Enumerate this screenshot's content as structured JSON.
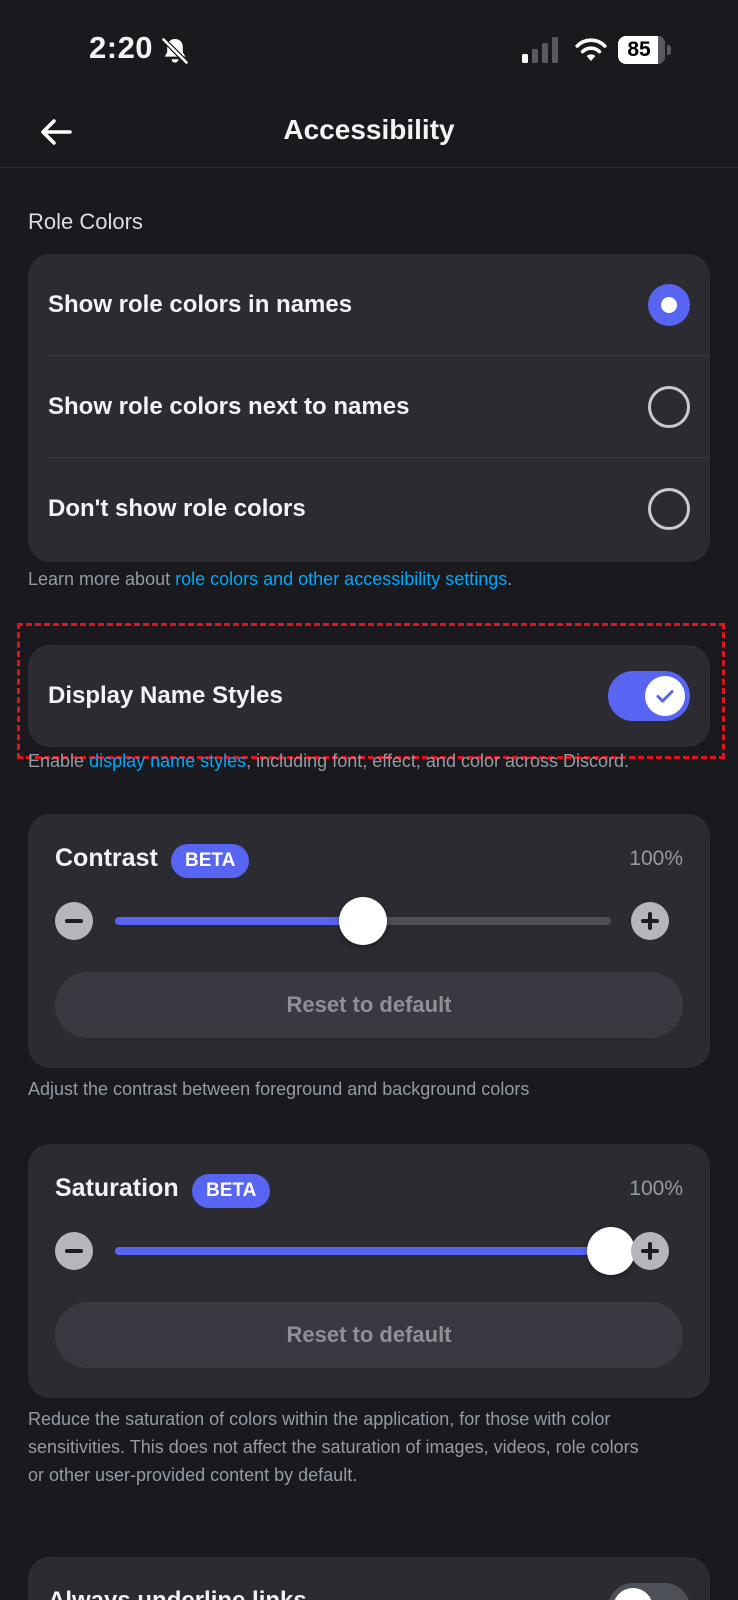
{
  "status_bar": {
    "time": "2:20",
    "battery": "85",
    "battery_level": 0.85
  },
  "nav": {
    "title": "Accessibility"
  },
  "role_colors": {
    "section_label": "Role Colors",
    "options": [
      {
        "label": "Show role colors in names",
        "selected": true
      },
      {
        "label": "Show role colors next to names",
        "selected": false
      },
      {
        "label": "Don't show role colors",
        "selected": false
      }
    ],
    "help_prefix": "Learn more about ",
    "help_link": "role colors and other accessibility settings",
    "help_suffix": "."
  },
  "display_name_styles": {
    "label": "Display Name Styles",
    "enabled": true,
    "help_prefix": "Enable ",
    "help_link": "display name styles",
    "help_suffix": ", including font, effect, and color across Discord."
  },
  "contrast": {
    "title": "Contrast",
    "badge": "BETA",
    "value_text": "100%",
    "slider_level": 0.5,
    "reset_label": "Reset to default",
    "help": "Adjust the contrast between foreground and background colors"
  },
  "saturation": {
    "title": "Saturation",
    "badge": "BETA",
    "value_text": "100%",
    "slider_level": 1.0,
    "reset_label": "Reset to default",
    "help_line1": "Reduce the saturation of colors within the application, for those with color",
    "help_line2": "sensitivities. This does not affect the saturation of images, videos, role colors",
    "help_line3": "or other user-provided content by default."
  },
  "next_setting": {
    "label": "Always underline links",
    "enabled": false
  },
  "colors": {
    "accent": "#5865f2",
    "background": "#1a1a1e",
    "card": "#2b2b31",
    "link": "#00a8fc",
    "highlight": "#e0131e"
  }
}
